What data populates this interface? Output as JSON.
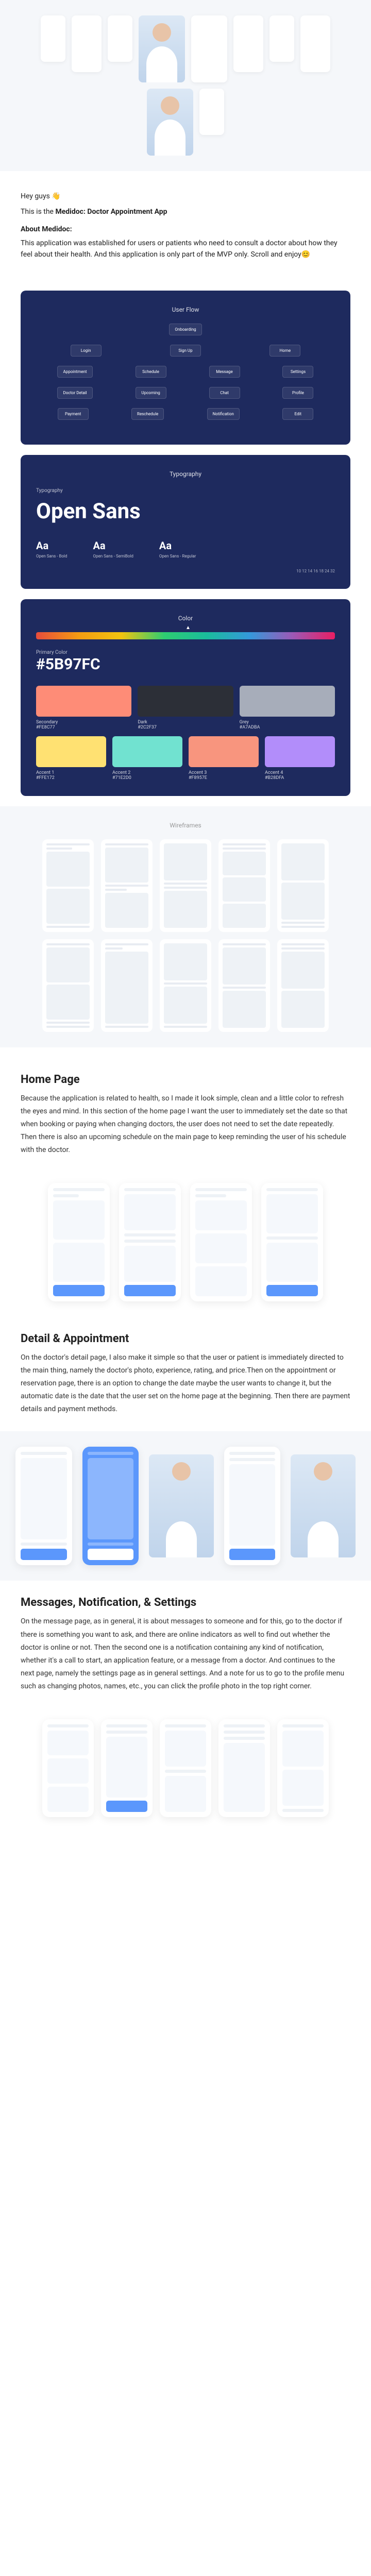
{
  "intro": {
    "greeting": "Hey guys 👋",
    "tagline": "This is the Medidoc: Doctor Appointment App",
    "about_heading": "About Medidoc:",
    "about_body": "This application was established for users or patients who need to consult a doctor about how they feel about their health. And this application is only part of the MVP only. Scroll and enjoy😊"
  },
  "userflow": {
    "title": "User Flow",
    "rows": [
      [
        "Onboarding"
      ],
      [
        "Login",
        "Sign Up",
        "Home"
      ],
      [
        "Appointment",
        "Schedule",
        "Message",
        "Settings"
      ],
      [
        "Doctor Detail",
        "Upcoming",
        "Chat",
        "Profile"
      ],
      [
        "Payment",
        "Reschedule",
        "Notification",
        "Edit"
      ]
    ]
  },
  "typography": {
    "title": "Typography",
    "label": "Typography",
    "family": "Open Sans",
    "weights": [
      {
        "sample": "Aa",
        "name": "Open Sans - Bold"
      },
      {
        "sample": "Aa",
        "name": "Open Sans - SemiBold"
      },
      {
        "sample": "Aa",
        "name": "Open Sans - Regular"
      }
    ],
    "scale_label": "10 12 14 16 18 24 32"
  },
  "color": {
    "title": "Color",
    "primary_label": "Primary Color",
    "primary": "#5B97FC",
    "swatches": [
      {
        "name": "Secondary",
        "hex": "#FE8C77",
        "css": "#fe8c77"
      },
      {
        "name": "Dark",
        "hex": "#2C2F37",
        "css": "#2c2f37"
      },
      {
        "name": "Grey",
        "hex": "#A7ADBA",
        "css": "#a7adba"
      },
      {
        "name": "Accent 1",
        "hex": "#FFE172",
        "css": "#ffe172"
      },
      {
        "name": "Accent 2",
        "hex": "#71E2D0",
        "css": "#71e2d0"
      },
      {
        "name": "Accent 3",
        "hex": "#F8957E",
        "css": "#f8957e"
      },
      {
        "name": "Accent 4",
        "hex": "#B28DFA",
        "css": "#b28dfa"
      }
    ]
  },
  "wireframes": {
    "title": "Wireframes"
  },
  "home": {
    "heading": "Home Page",
    "body": "Because the application is related to health, so I made it look simple, clean and a little color to refresh the eyes and mind. In this section of the home page I want the user to immediately set the date so that when booking or paying when changing doctors, the user does not need to set the date repeatedly. Then there is also an upcoming schedule on the main page to keep reminding the user of his schedule with the doctor."
  },
  "detail": {
    "heading": "Detail & Appointment",
    "body": "On the doctor's detail page, I also make it simple so that the user or patient is immediately directed to the main thing, namely the doctor's photo, experience, rating, and price.Then on the appointment or reservation page, there is an option to change the date maybe the user wants to change it, but the automatic date is the date that the user set on the home page at the beginning. Then there are payment details and payment methods."
  },
  "messages": {
    "heading": "Messages, Notification, & Settings",
    "body": "On the message page, as in general, it is about messages to someone and for this, go to the doctor if there is something you want to ask, and there are online indicators as well to find out whether the doctor is online or not. Then the second one is a notification containing any kind of notification, whether it's a call to start, an application feature, or a message from a doctor. And continues to the next page, namely the settings page as in general settings. And a note for us to go to the profile menu such as changing photos, names, etc., you can click the profile photo in the top right corner."
  }
}
